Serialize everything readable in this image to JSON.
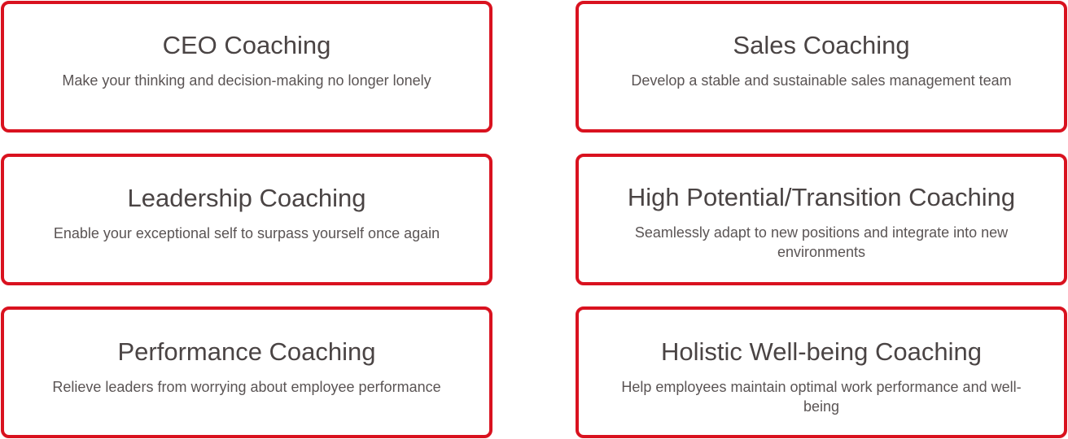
{
  "cards": [
    {
      "title": "CEO Coaching",
      "description": "Make your thinking and decision-making no longer lonely"
    },
    {
      "title": "Sales Coaching",
      "description": "Develop a stable and sustainable sales management team"
    },
    {
      "title": "Leadership Coaching",
      "description": "Enable your exceptional self to surpass yourself once again"
    },
    {
      "title": "High Potential/Transition Coaching",
      "description": "Seamlessly adapt to new positions and integrate into new environments"
    },
    {
      "title": "Performance Coaching",
      "description": "Relieve leaders from worrying about employee performance"
    },
    {
      "title": "Holistic Well-being Coaching",
      "description": "Help employees maintain optimal work performance and well-being"
    }
  ],
  "theme": {
    "accent": "#d9121f",
    "text": "#4a4444"
  }
}
